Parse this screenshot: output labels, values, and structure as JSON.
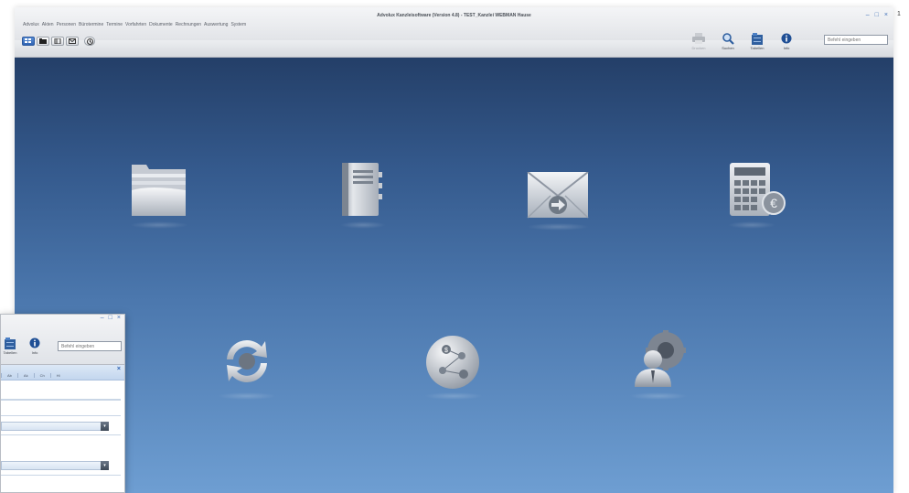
{
  "main_window": {
    "title": "Advolux Kanzleisoftware (Version 4.8) - TEST_Kanzlei WEBMAN Hause",
    "menu": [
      "Advolux",
      "Akten",
      "Personen",
      "Bürotermine",
      "Termine",
      "Vorfahrten",
      "Dokumente",
      "Rechnungen",
      "Auswertung",
      "System"
    ],
    "window_controls": {
      "minimize": "–",
      "maximize": "□",
      "close": "×"
    },
    "toolbar": {
      "print": "Drucken",
      "search": "Suchen",
      "tabs": "Tabellen",
      "info": "Info",
      "command_placeholder": "Befehl eingeben"
    }
  },
  "tiles": [
    {
      "name": "folder",
      "icon": "folder-icon"
    },
    {
      "name": "address-book",
      "icon": "address-book-icon"
    },
    {
      "name": "mail",
      "icon": "mail-icon"
    },
    {
      "name": "calculator",
      "icon": "calculator-euro-icon"
    },
    {
      "name": "sync",
      "icon": "sync-icon"
    },
    {
      "name": "globe",
      "icon": "globe-icon"
    },
    {
      "name": "admin",
      "icon": "user-gear-icon"
    }
  ],
  "secondary_window": {
    "window_controls": {
      "minimize": "–",
      "maximize": "□",
      "close": "×"
    },
    "toolbar": {
      "tabs": "Tabellen",
      "info": "Info",
      "command_placeholder": "Befehl eingeben"
    },
    "panel_tabs": [
      "Ab",
      "Ak",
      "Ch",
      "Hi"
    ],
    "panel_close": "×",
    "dropdown_arrow": "▾"
  },
  "edge_char": "1",
  "colors": {
    "accent": "#2f64b3",
    "background_top": "#243f68",
    "background_bottom": "#6e9ed2"
  }
}
